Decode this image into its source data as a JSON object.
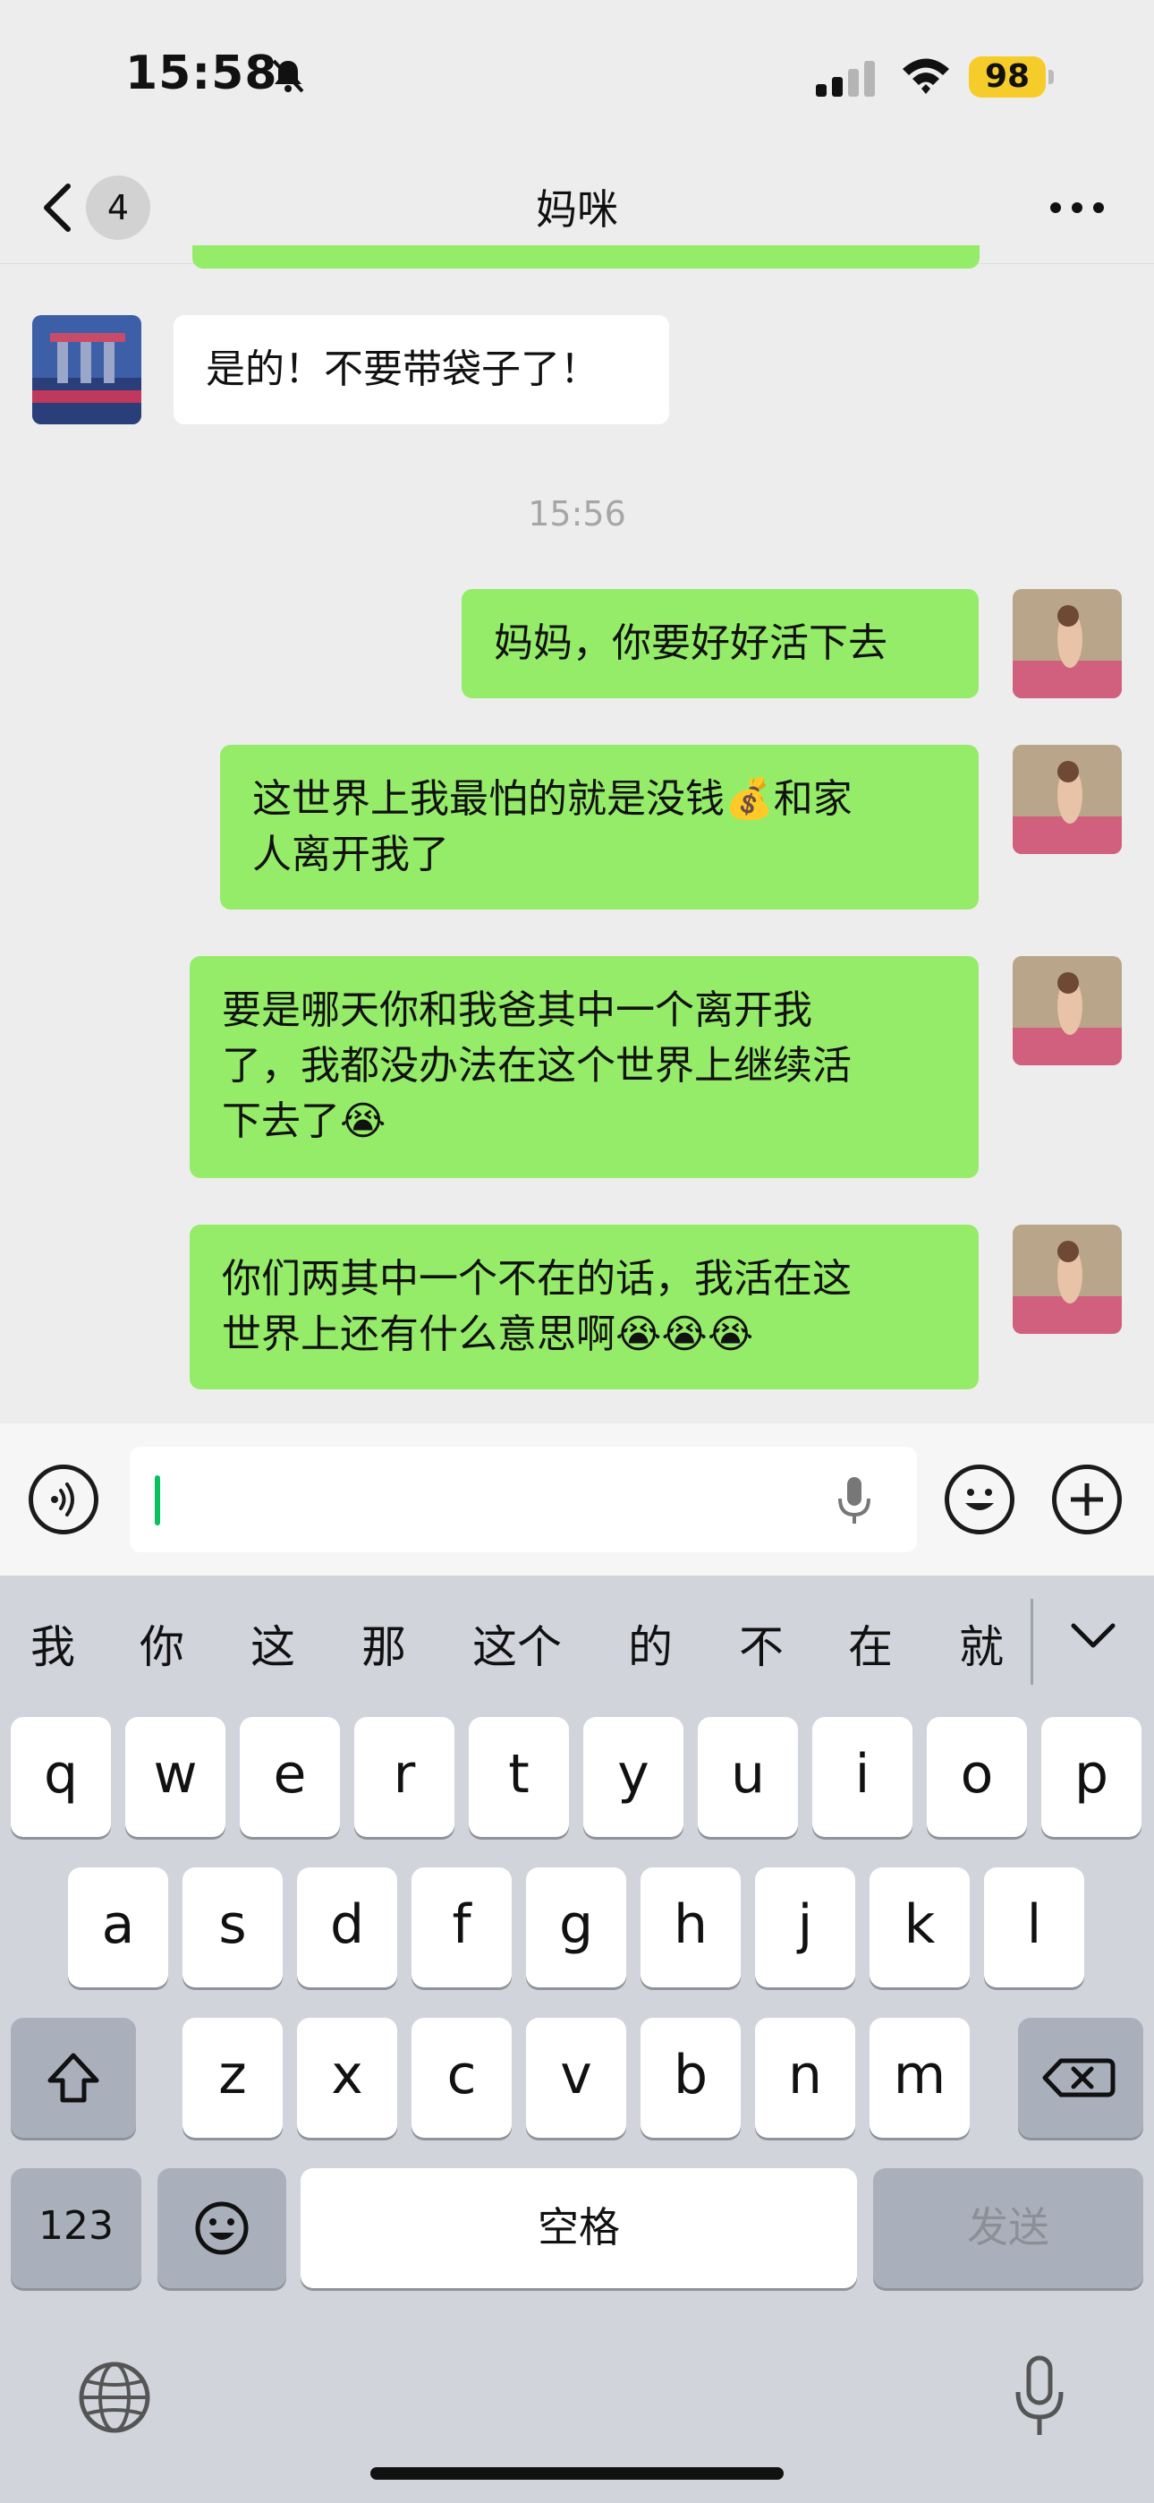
{
  "status_bar": {
    "time": "15:58",
    "battery": "98",
    "colors": {
      "battery": "#f5cc2a"
    }
  },
  "nav": {
    "back_badge": "4",
    "title": "妈咪",
    "icons": {
      "back": "chevron-left-icon",
      "more": "more-icon"
    }
  },
  "chat": {
    "timestamp": "15:56",
    "messages": [
      {
        "sender": "contact",
        "text": "是的！不要带袋子了！"
      },
      {
        "sender": "me",
        "text": "妈妈，你要好好活下去"
      },
      {
        "sender": "me",
        "line1": "这世界上我最怕的就是没钱💰和家",
        "line2": "人离开我了"
      },
      {
        "sender": "me",
        "line1": "要是哪天你和我爸其中一个离开我",
        "line2": "了，我都没办法在这个世界上继续活",
        "line3": "下去了😭"
      },
      {
        "sender": "me",
        "line1": "你们两其中一个不在的话，我活在这",
        "line2": "世界上还有什么意思啊😭😭😭"
      }
    ],
    "colors": {
      "outgoing": "#95ec69",
      "incoming": "#ffffff"
    }
  },
  "input_bar": {
    "text_value": "",
    "icons": {
      "voice": "voice-icon",
      "mic": "microphone-icon",
      "emoji": "emoji-icon",
      "plus": "plus-icon"
    }
  },
  "keyboard": {
    "candidates": [
      "我",
      "你",
      "这",
      "那",
      "这个",
      "的",
      "不",
      "在",
      "就"
    ],
    "row1": [
      "q",
      "w",
      "e",
      "r",
      "t",
      "y",
      "u",
      "i",
      "o",
      "p"
    ],
    "row2": [
      "a",
      "s",
      "d",
      "f",
      "g",
      "h",
      "j",
      "k",
      "l"
    ],
    "row3": [
      "z",
      "x",
      "c",
      "v",
      "b",
      "n",
      "m"
    ],
    "numbers_key": "123",
    "space_key": "空格",
    "send_key": "发送",
    "icons": {
      "shift": "shift-icon",
      "delete": "delete-icon",
      "emoji": "emoji-icon",
      "globe": "globe-icon",
      "mic": "microphone-icon",
      "collapse": "chevron-down-icon"
    }
  }
}
